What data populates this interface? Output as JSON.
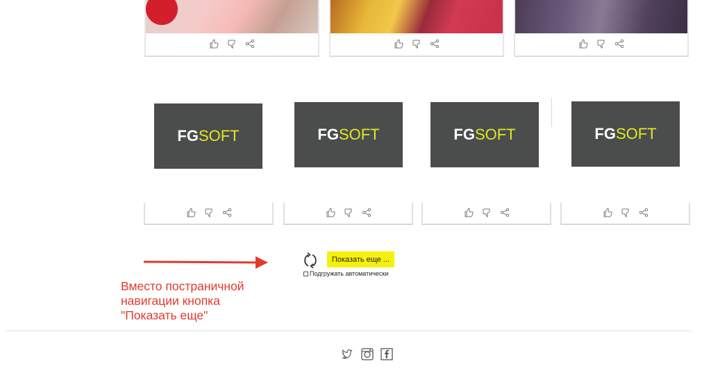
{
  "top_cards": [
    {
      "image": "child-photo",
      "actions": [
        "like-icon",
        "dislike-icon",
        "share-icon"
      ]
    },
    {
      "image": "car-photo",
      "actions": [
        "like-icon",
        "dislike-icon",
        "share-icon"
      ]
    },
    {
      "image": "purple-photo",
      "actions": [
        "like-icon",
        "dislike-icon",
        "share-icon"
      ]
    }
  ],
  "logos": [
    {
      "bold": "FG",
      "light": "SOFT"
    },
    {
      "bold": "FG",
      "light": "SOFT"
    },
    {
      "bold": "FG",
      "light": "SOFT"
    },
    {
      "bold": "FG",
      "light": "SOFT"
    }
  ],
  "load_more": {
    "button_label": "Показать еще ...",
    "auto_label": "Подгружать автоматически",
    "auto_checked": false,
    "icon": "reload-icon"
  },
  "annotation": {
    "lines": [
      "Вместо постраничной",
      "навигации кнопка",
      "\"Показать еще\""
    ],
    "color": "#e23a2c"
  },
  "footer": {
    "social": [
      "twitter-icon",
      "instagram-icon",
      "facebook-icon"
    ]
  },
  "colors": {
    "button_bg": "#f6f10b",
    "logo_bg": "#4a4d4c",
    "logo_accent": "#e3e822"
  }
}
